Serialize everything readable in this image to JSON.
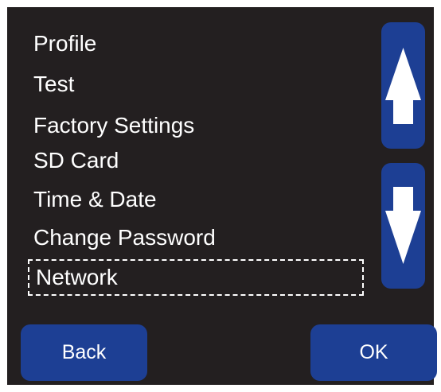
{
  "menu": {
    "items": [
      {
        "label": "Profile"
      },
      {
        "label": "Test"
      },
      {
        "label": "Factory Settings"
      },
      {
        "label": "SD Card"
      },
      {
        "label": "Time & Date"
      },
      {
        "label": "Change Password"
      },
      {
        "label": "Network"
      }
    ],
    "selected_label": "Network"
  },
  "scroll": {
    "up_icon": "arrow-up-icon",
    "down_icon": "arrow-down-icon"
  },
  "buttons": {
    "back_label": "Back",
    "ok_label": "OK"
  },
  "colors": {
    "screen_background": "#231f20",
    "button_blue": "#1d3f94",
    "text": "#ffffff"
  }
}
